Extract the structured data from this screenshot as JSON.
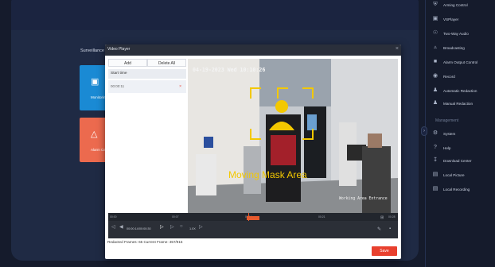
{
  "background": {
    "section_label": "Surveillance",
    "tiles": [
      {
        "label": "Monitoring",
        "icon": "monitor-icon",
        "color": "#1a8ad4"
      },
      {
        "label": "Alarm Center",
        "icon": "bell-icon",
        "color": "#ec6a4e"
      }
    ]
  },
  "sidebar": {
    "items": [
      {
        "label": "Arming Control",
        "icon": "shield-icon"
      },
      {
        "label": "VSPlayer",
        "icon": "player-icon"
      },
      {
        "label": "Two-Way Audio",
        "icon": "microphone-icon"
      },
      {
        "label": "Broadcasting",
        "icon": "broadcast-icon"
      },
      {
        "label": "Alarm Output Control",
        "icon": "alarm-output-icon"
      },
      {
        "label": "Record",
        "icon": "record-icon"
      },
      {
        "label": "Automatic Redaction",
        "icon": "redaction-auto-icon"
      },
      {
        "label": "Manual Redaction",
        "icon": "redaction-manual-icon"
      }
    ],
    "section_title": "Management",
    "management_items": [
      {
        "label": "System",
        "icon": "system-icon"
      },
      {
        "label": "Help",
        "icon": "help-icon"
      },
      {
        "label": "Download Center",
        "icon": "download-icon"
      },
      {
        "label": "Local Picture",
        "icon": "picture-icon"
      },
      {
        "label": "Local Recording",
        "icon": "recording-icon"
      }
    ]
  },
  "modal": {
    "title": "Video Player",
    "close_label": "×",
    "add_label": "Add",
    "delete_all_label": "Delete All",
    "list_header": "Start time",
    "list_rows": [
      {
        "time": "00:00:11",
        "delete": "×"
      }
    ],
    "video": {
      "timestamp": "04-19-2023 Wed 10:10:26",
      "mask_label": "Moving Mask Area",
      "entrance_label": "Working Area Entrance"
    },
    "timeline": {
      "ticks": [
        "00:00",
        "00:07",
        "00:14",
        "00:21",
        "00:28"
      ],
      "current_time": "00:00:14/00:00:30",
      "speed": "1.0X"
    },
    "footer_status": "Redacted Frames: 65  Current Frame: 357/915",
    "save_label": "Save"
  }
}
